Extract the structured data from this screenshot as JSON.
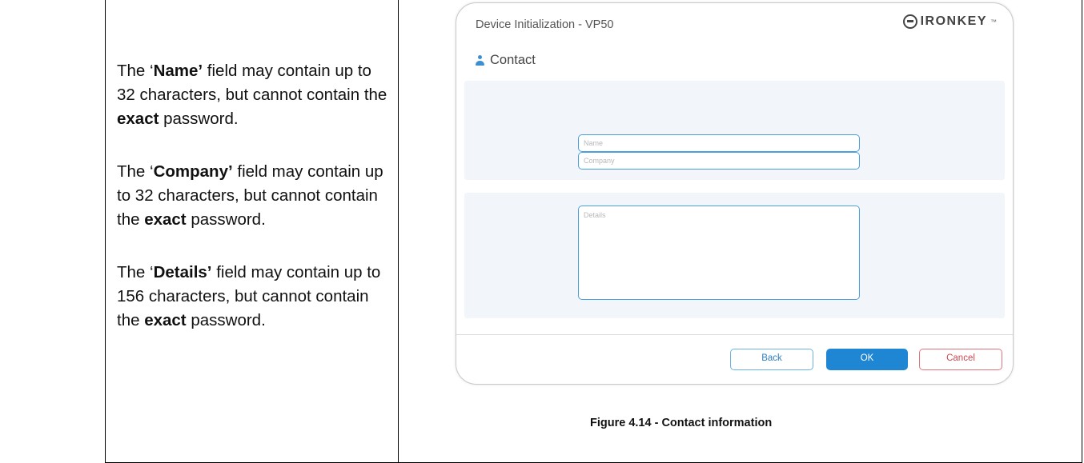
{
  "left_panel": {
    "para1": {
      "open": "The ‘",
      "bold1": "Name’",
      "mid": " field may contain up to 32 characters, but cannot contain the ",
      "bold2": "exact",
      "end": " password."
    },
    "para2": {
      "open": "The ‘",
      "bold1": "Company’",
      "mid": " field may contain up to 32 characters, but cannot contain the ",
      "bold2": "exact",
      "end": " password."
    },
    "para3": {
      "open": "The ‘",
      "bold1": "Details’",
      "mid": " field may contain up to 156 characters, but cannot contain the ",
      "bold2": "exact",
      "end": " password."
    }
  },
  "dialog": {
    "title": "Device Initialization - VP50",
    "logo_text": "IRONKEY",
    "logo_tm": "™",
    "section_title": "Contact",
    "name_placeholder": "Name",
    "company_placeholder": "Company",
    "details_placeholder": "Details",
    "buttons": {
      "back": "Back",
      "ok": "OK",
      "cancel": "Cancel"
    }
  },
  "caption": "Figure 4.14 - Contact information",
  "colors": {
    "accent": "#1f86d3",
    "field_border": "#4aa0dc",
    "cancel": "#d04650",
    "panel_bg": "#f2f6fb"
  },
  "icons": {
    "section": "user-icon",
    "logo": "ironkey-logo-mark"
  }
}
